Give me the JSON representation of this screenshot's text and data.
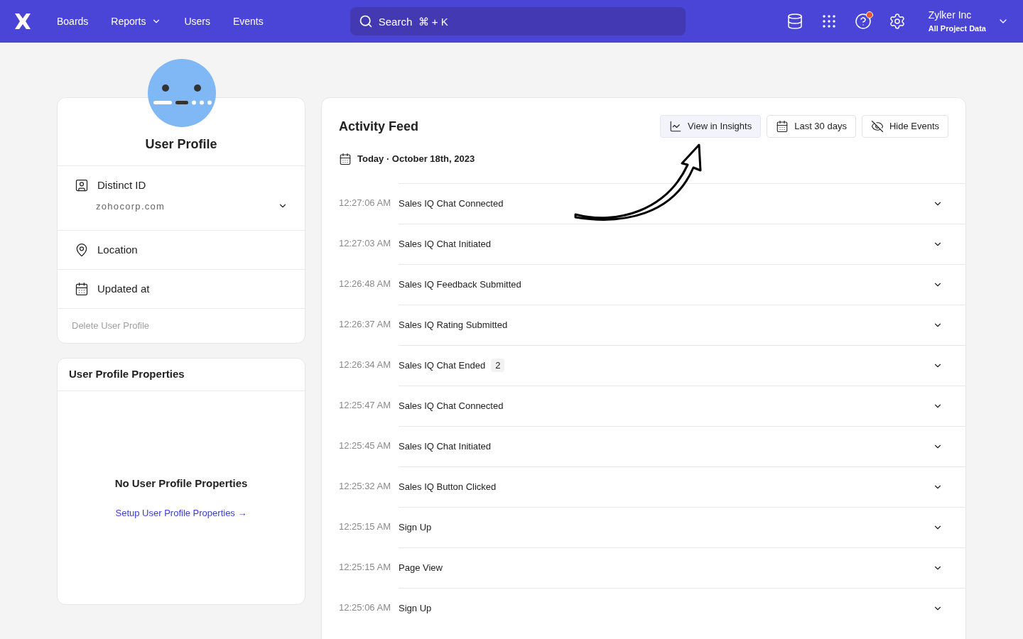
{
  "nav": {
    "items": [
      {
        "label": "Boards",
        "dropdown": false
      },
      {
        "label": "Reports",
        "dropdown": true
      },
      {
        "label": "Users",
        "dropdown": false
      },
      {
        "label": "Events",
        "dropdown": false
      }
    ],
    "search": {
      "placeholder": "Search  ⌘ + K"
    },
    "help_badge": true,
    "account": {
      "name": "Zylker Inc",
      "project": "All Project Data"
    }
  },
  "profile": {
    "title": "User Profile",
    "distinct_id_label": "Distinct ID",
    "distinct_id": "zohocorp.com",
    "location_label": "Location",
    "updated_label": "Updated at",
    "delete": "Delete User Profile"
  },
  "properties": {
    "title": "User Profile Properties",
    "empty": "No User Profile Properties",
    "setup_link": "Setup User Profile Properties →"
  },
  "feed": {
    "title": "Activity Feed",
    "buttons": [
      {
        "kind": "chart",
        "label": "View in Insights",
        "selected": true
      },
      {
        "kind": "calendar",
        "label": "Last 30 days",
        "selected": false
      },
      {
        "kind": "hide",
        "label": "Hide Events",
        "selected": false
      }
    ],
    "date": "Today · October 18th, 2023",
    "rows": [
      {
        "time": "12:27:06 AM",
        "event": "Sales IQ Chat Connected"
      },
      {
        "time": "12:27:03 AM",
        "event": "Sales IQ Chat Initiated"
      },
      {
        "time": "12:26:48 AM",
        "event": "Sales IQ Feedback Submitted"
      },
      {
        "time": "12:26:37 AM",
        "event": "Sales IQ Rating Submitted"
      },
      {
        "time": "12:26:34 AM",
        "event": "Sales IQ Chat Ended",
        "count": "2"
      },
      {
        "time": "12:25:47 AM",
        "event": "Sales IQ Chat Connected"
      },
      {
        "time": "12:25:45 AM",
        "event": "Sales IQ Chat Initiated"
      },
      {
        "time": "12:25:32 AM",
        "event": "Sales IQ Button Clicked"
      },
      {
        "time": "12:25:15 AM",
        "event": "Sign Up"
      },
      {
        "time": "12:25:15 AM",
        "event": "Page View"
      },
      {
        "time": "12:25:06 AM",
        "event": "Sign Up"
      }
    ]
  }
}
